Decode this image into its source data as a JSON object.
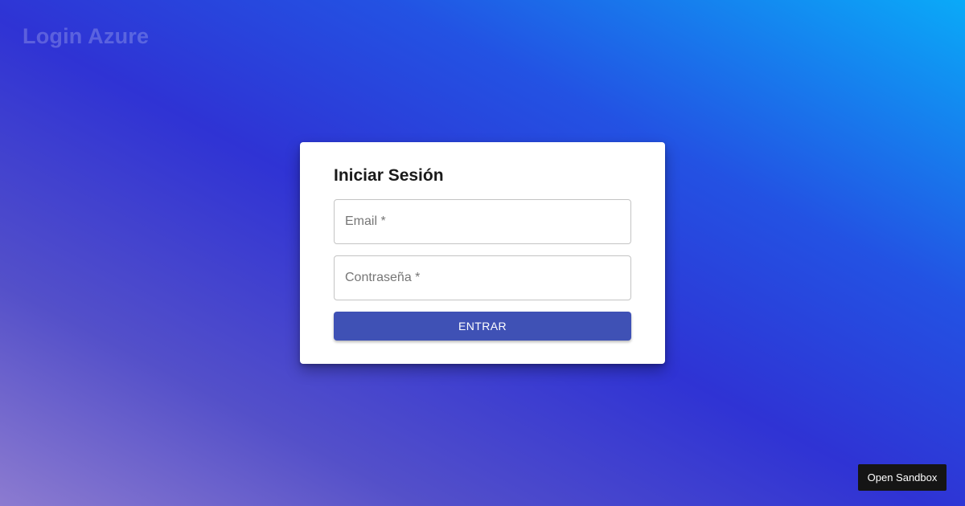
{
  "header": {
    "app_title": "Login Azure"
  },
  "login": {
    "title": "Iniciar Sesión",
    "email": {
      "value": "",
      "placeholder": "Email *"
    },
    "password": {
      "value": "",
      "placeholder": "Contraseña *"
    },
    "submit_label": "ENTRAR"
  },
  "footer": {
    "sandbox_label": "Open Sandbox"
  },
  "colors": {
    "primary_button": "#3f51b5",
    "card_background": "#ffffff",
    "sandbox_button": "#151515",
    "background_gradient": [
      "#8c7bd0",
      "#2f33d4",
      "#0aaaf8"
    ]
  }
}
